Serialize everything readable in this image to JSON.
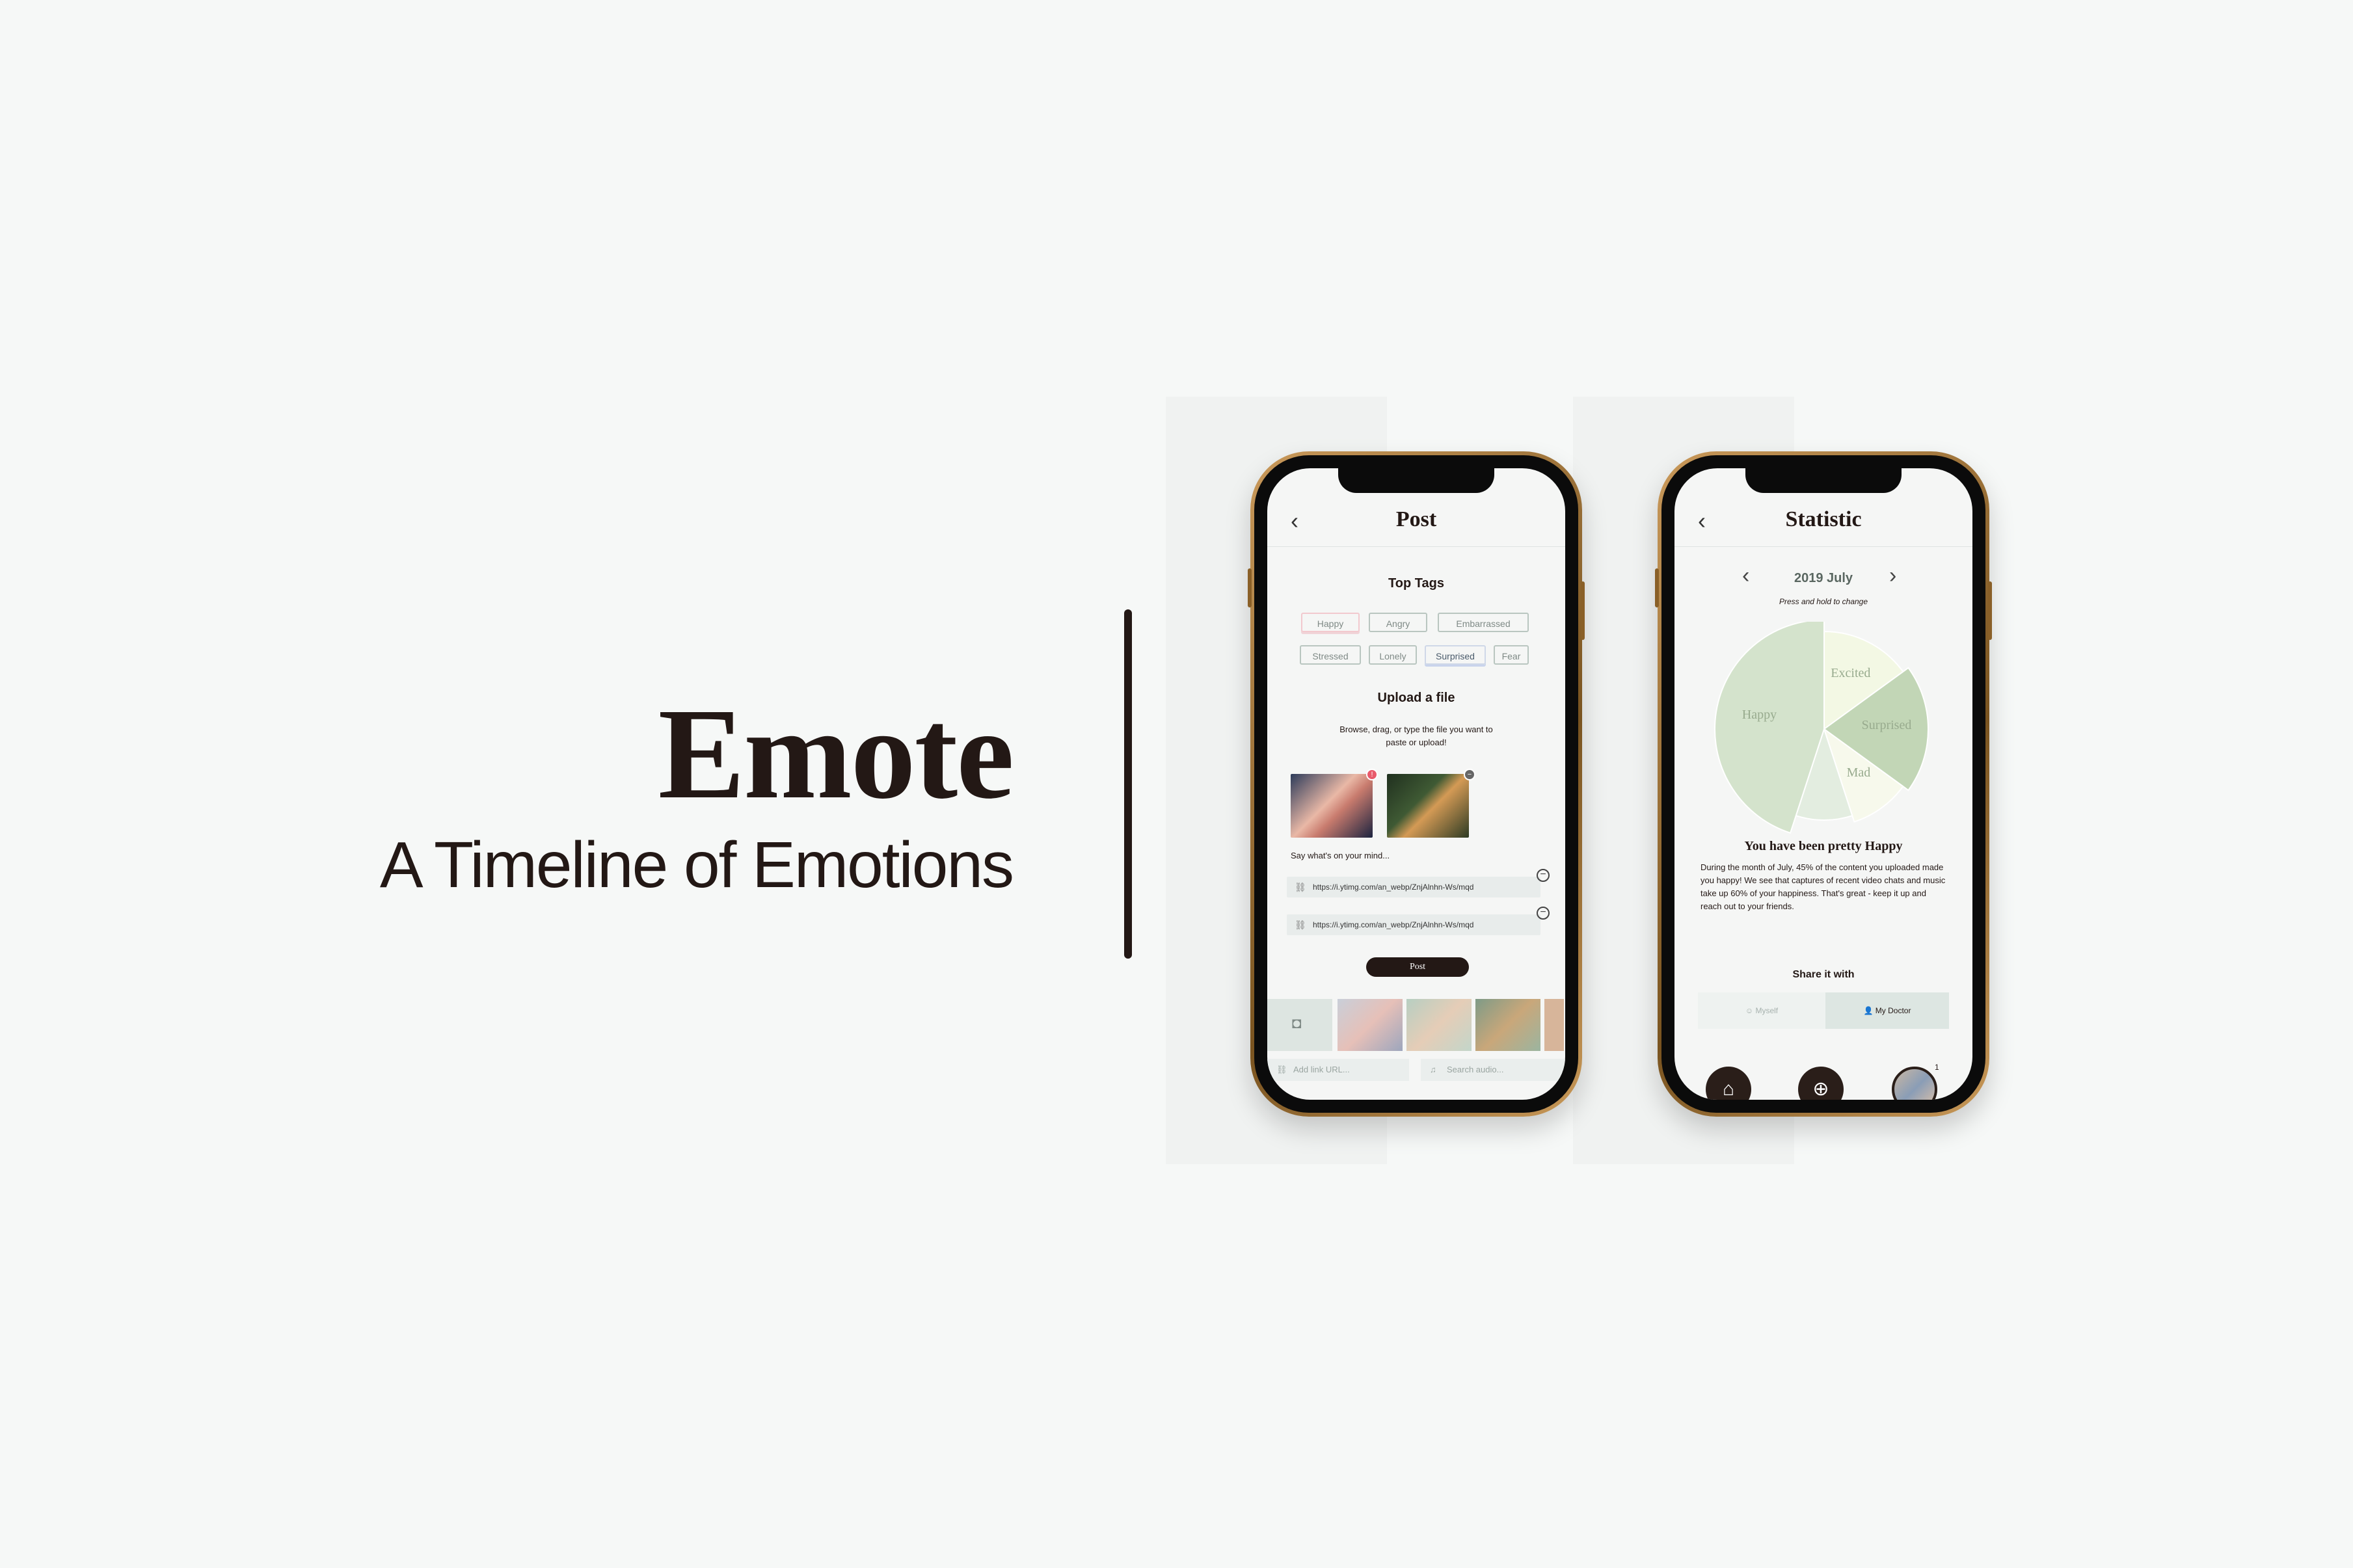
{
  "brand": {
    "title": "Emote",
    "subtitle": "A Timeline of Emotions"
  },
  "post_screen": {
    "title": "Post",
    "top_tags_title": "Top Tags",
    "tags": [
      "Happy",
      "Angry",
      "Embarrassed",
      "Stressed",
      "Lonely",
      "Surprised",
      "Fear"
    ],
    "upload_title": "Upload a file",
    "upload_hint": "Browse, drag, or type the file you want to paste or upload!",
    "mind_placeholder": "Say what's on your mind...",
    "urls": [
      "https://i.ytimg.com/an_webp/ZnjAlnhn-Ws/mqd",
      "https://i.ytimg.com/an_webp/ZnjAlnhn-Ws/mqd"
    ],
    "post_button": "Post",
    "link_placeholder": "Add link URL...",
    "audio_placeholder": "Search audio..."
  },
  "statistic_screen": {
    "title": "Statistic",
    "period": "2019 July",
    "period_hint": "Press and hold to change",
    "summary_title": "You have been pretty Happy",
    "summary_text": "During the month of July, 45% of the content you uploaded made you happy! We see that captures of recent video chats and music take up 60% of your happiness. That's great - keep it up and reach out to your friends.",
    "share_title": "Share it with",
    "share_options": [
      "Myself",
      "My Doctor"
    ],
    "avatar_badge": "1"
  },
  "chart_data": {
    "type": "pie",
    "slices": [
      {
        "label": "Happy",
        "value": 45,
        "color": "#d4e3cc"
      },
      {
        "label": "Excited",
        "value": 15,
        "color": "#f3f8e4"
      },
      {
        "label": "Surprised",
        "value": 20,
        "color": "#c2d6b6"
      },
      {
        "label": "Mad",
        "value": 10,
        "color": "#f7f9ec"
      },
      {
        "label": "",
        "value": 10,
        "color": "#e3ede0"
      }
    ],
    "title": "",
    "xlabel": "",
    "ylabel": ""
  },
  "colors": {
    "background": "#f6f8f7",
    "ink": "#231815",
    "accent_green": "#98ab8e",
    "gold": "#a9793a"
  }
}
